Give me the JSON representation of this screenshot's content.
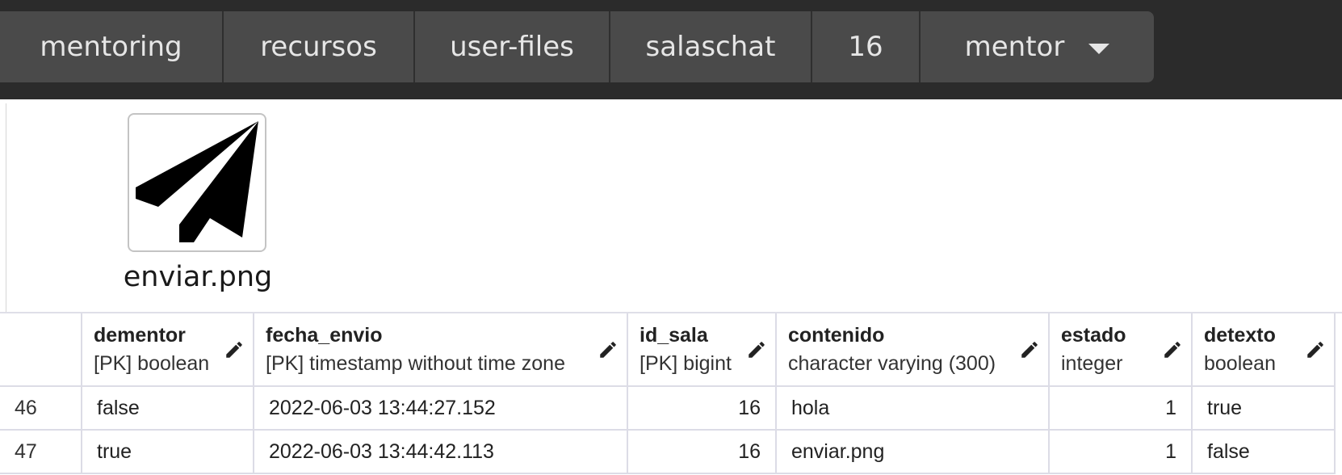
{
  "breadcrumb": {
    "items": [
      "mentoring",
      "recursos",
      "user-files",
      "salaschat",
      "16",
      "mentor"
    ]
  },
  "preview": {
    "file_name": "enviar.png",
    "icon": "send-paper-plane-icon"
  },
  "table": {
    "columns": [
      {
        "name": "dementor",
        "type": "[PK] boolean"
      },
      {
        "name": "fecha_envio",
        "type": "[PK] timestamp without time zone"
      },
      {
        "name": "id_sala",
        "type": "[PK] bigint"
      },
      {
        "name": "contenido",
        "type": "character varying (300)"
      },
      {
        "name": "estado",
        "type": "integer"
      },
      {
        "name": "detexto",
        "type": "boolean"
      }
    ],
    "rows": [
      {
        "num": "46",
        "cells": [
          "false",
          "2022-06-03 13:44:27.152",
          "16",
          "hola",
          "1",
          "true"
        ]
      },
      {
        "num": "47",
        "cells": [
          "true",
          "2022-06-03 13:44:42.113",
          "16",
          "enviar.png",
          "1",
          "false"
        ]
      }
    ]
  },
  "colors": {
    "topbar_bg": "#2b2b2b",
    "crumb_bg": "#4a4a4a",
    "crumb_text": "#e6e6e6",
    "grid_border": "#dcdce6"
  }
}
